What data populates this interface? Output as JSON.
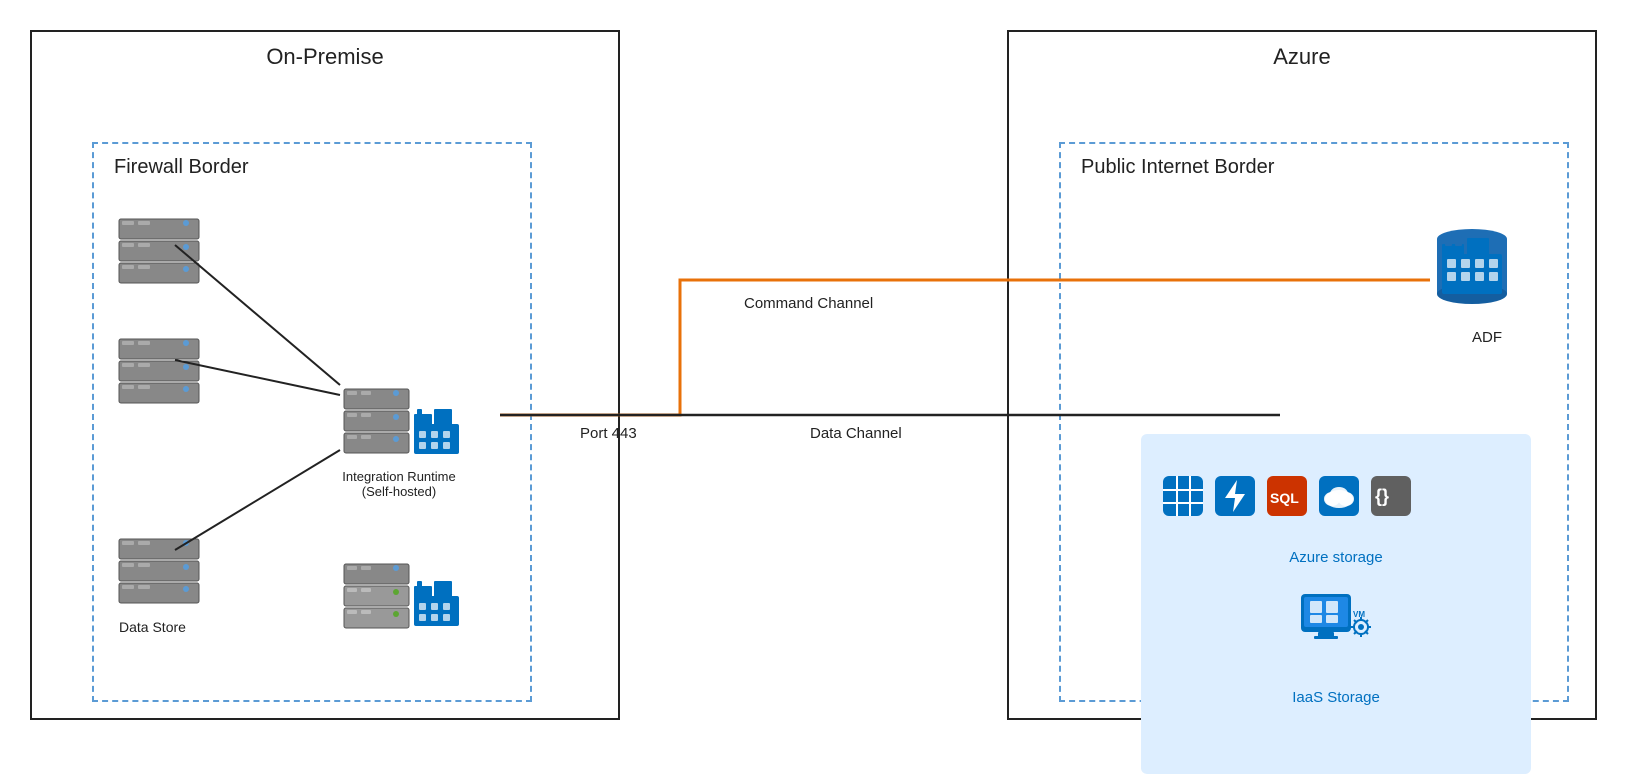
{
  "onpremise": {
    "title": "On-Premise",
    "firewall_border": "Firewall Border",
    "data_store_label": "Data Store",
    "integration_runtime_label": "Integration Runtime\n(Self-hosted)"
  },
  "azure": {
    "title": "Azure",
    "public_border": "Public Internet Border",
    "adf_label": "ADF",
    "azure_storage_label": "Azure storage",
    "iaas_label": "IaaS Storage"
  },
  "connections": {
    "command_channel": "Command Channel",
    "data_channel": "Data Channel",
    "port_label": "Port 443"
  },
  "colors": {
    "orange": "#e8710a",
    "black": "#222222",
    "blue": "#0070c0",
    "dashed_border": "#5b9bd5"
  }
}
